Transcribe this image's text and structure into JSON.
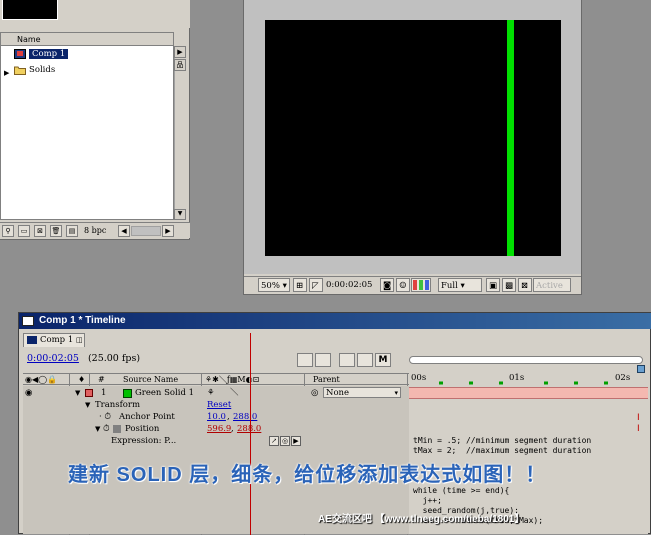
{
  "project": {
    "column_name": "Name",
    "items": [
      {
        "label": "Comp 1",
        "icon": "comp-icon",
        "selected": true
      },
      {
        "label": "Solids",
        "icon": "folder-icon",
        "selected": false
      }
    ],
    "bpc": "8 bpc"
  },
  "viewer": {
    "zoom": "50%",
    "timecode": "0:00:02:05",
    "resolution": "Full",
    "camera": "Active",
    "line_color": "#00e000"
  },
  "timeline": {
    "title": "Comp 1 * Timeline",
    "tab": "Comp 1",
    "current_time": "0:00:02:05",
    "fps": "(25.00 fps)",
    "columns": {
      "source_name": "Source Name",
      "parent": "Parent"
    },
    "layer": {
      "index": "1",
      "name": "Green Solid 1",
      "parent": "None",
      "color": "#00c000"
    },
    "transform": {
      "label": "Transform",
      "reset": "Reset",
      "anchor_label": "Anchor Point",
      "anchor_x": "10.0",
      "anchor_y": "288.0",
      "position_label": "Position",
      "position_x": "596.9",
      "position_y": "288.0",
      "expression_label": "Expression: P..."
    },
    "ruler": {
      "start": "00s",
      "mid": "01s",
      "end": "02s"
    },
    "expression_lines": [
      "tMin = .5; //minimum segment duration",
      "tMax = 2;  //maximum segment duration",
      "",
      "",
      "",
      "while (time >= end){",
      "  j++;",
      "  seed_random(j,true);",
      "  end += random(tMin,tMax);"
    ]
  },
  "caption": "建新 SOLID 层，细条，给位移添加表达式如图！！",
  "watermark": "AE交流区吧  【www.tlneeg.com/tieba/1801】"
}
